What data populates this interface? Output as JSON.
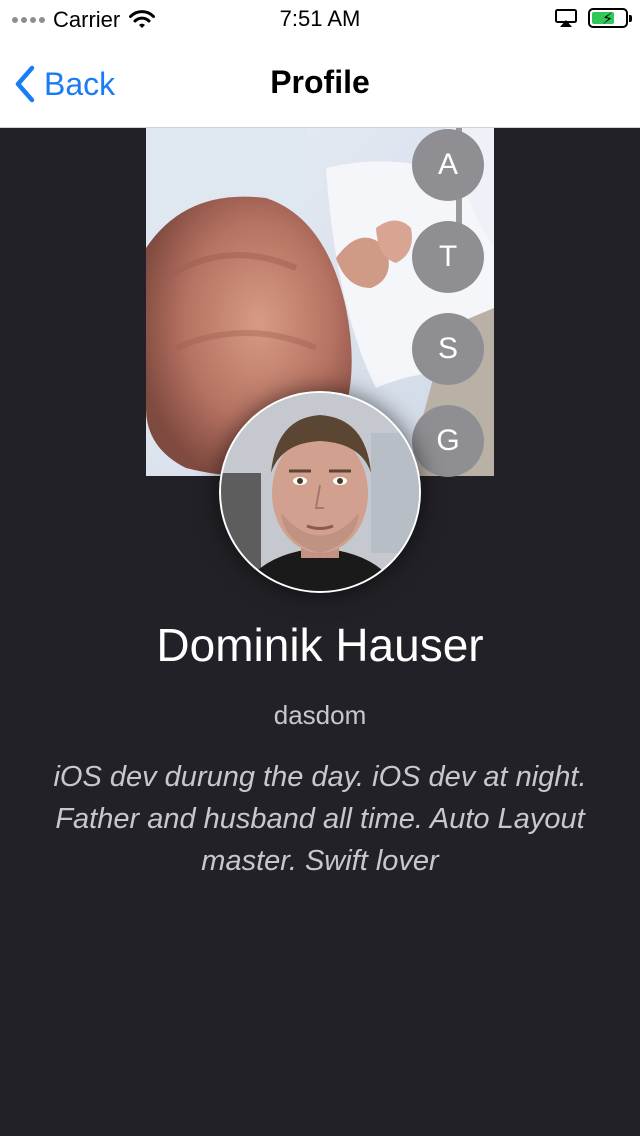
{
  "status_bar": {
    "carrier": "Carrier",
    "time": "7:51 AM",
    "icons": [
      "signal-dots-icon",
      "wifi-icon",
      "airplay-icon",
      "battery-charging-icon"
    ]
  },
  "nav": {
    "back_label": "Back",
    "title": "Profile"
  },
  "tags": [
    {
      "label": "A"
    },
    {
      "label": "T"
    },
    {
      "label": "S"
    },
    {
      "label": "G"
    }
  ],
  "profile": {
    "name": "Dominik Hauser",
    "handle": "dasdom",
    "bio": "iOS dev durung the day. iOS dev at night. Father and husband all time. Auto Layout master. Swift lover"
  },
  "colors": {
    "background": "#222127",
    "accent": "#1a7cf4",
    "tag_bg": "#8f8f93",
    "battery": "#32c759"
  }
}
